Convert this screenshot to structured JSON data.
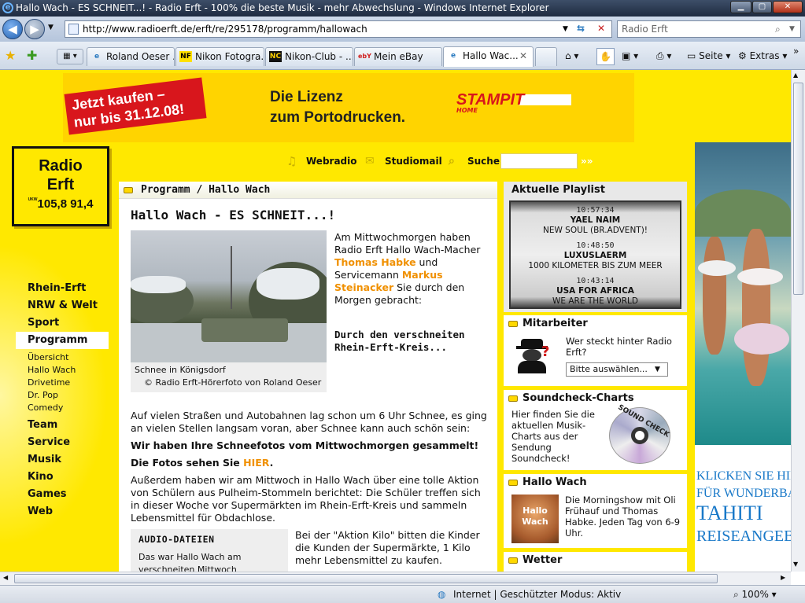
{
  "window": {
    "title": "Hallo Wach - ES SCHNEIT...! - Radio Erft - 100% die beste Musik - mehr Abwechslung - Windows Internet Explorer",
    "minimize": "▁",
    "maximize": "▢",
    "close": "✕"
  },
  "address": {
    "url": "http://www.radioerft.de/erft/re/295178/programm/hallowach",
    "search_placeholder": "Radio Erft"
  },
  "tabs": [
    {
      "label": "Roland Oeser ...",
      "fav": "e"
    },
    {
      "label": "Nikon Fotogra...",
      "fav": "NF"
    },
    {
      "label": "Nikon-Club - ...",
      "fav": "NC"
    },
    {
      "label": "Mein eBay",
      "fav": "ebY"
    },
    {
      "label": "Hallo Wac...",
      "fav": "e"
    }
  ],
  "toolbar": {
    "seite": "Seite",
    "extras": "Extras"
  },
  "banner": {
    "red_line1": "Jetzt kaufen –",
    "red_line2": "nur bis 31.12.08!",
    "text_line1": "Die Lizenz",
    "text_line2": "zum Portodrucken.",
    "brand": "STAMPIT",
    "brand_sub": "HOME"
  },
  "logo": {
    "line1": "Radio",
    "line2": "Erft",
    "freq": "105,8 91,4",
    "ukw1": "UKW",
    "ukw2": "UKW"
  },
  "topnav": {
    "webradio": "Webradio",
    "studiomail": "Studiomail",
    "suche": "Suche",
    "go": "»»"
  },
  "nav": {
    "main": [
      "Rhein-Erft",
      "NRW & Welt",
      "Sport",
      "Programm"
    ],
    "sub": [
      "Übersicht",
      "Hallo Wach",
      "Drivetime",
      "Dr. Pop",
      "Comedy"
    ],
    "more": [
      "Team",
      "Service",
      "Musik",
      "Kino",
      "Games",
      "Web"
    ]
  },
  "article": {
    "breadcrumb": "Programm / Hallo Wach",
    "title": "Hallo Wach - ES SCHNEIT...!",
    "caption": "Schnee in Königsdorf",
    "credit": "© Radio Erft-Hörerfoto von Roland Oeser",
    "intro_1": "Am Mittwochmorgen haben Radio Erft Hallo Wach-Macher ",
    "intro_name1": "Thomas Habke",
    "intro_2": " und Servicemann ",
    "intro_name2": "Markus Steinacker",
    "intro_3": " Sie durch den Morgen gebracht:",
    "subhead": "Durch den verschneiten Rhein-Erft-Kreis...",
    "para1": "Auf vielen Straßen und Autobahnen lag schon um 6 Uhr Schnee, es ging an vielen Stellen langsam voran, aber Schnee kann auch schön sein:",
    "bold1": "Wir haben Ihre Schneefotos vom Mittwochmorgen gesammelt!",
    "bold2_a": "Die Fotos sehen Sie ",
    "bold2_link": "HIER",
    "bold2_b": ".",
    "para2": "Außerdem haben wir am Mittwoch in Hallo Wach über eine tolle Aktion von Schülern aus Pulheim-Stommeln berichtet: Die Schüler treffen sich in dieser Woche vor Supermärkten im Rhein-Erft-Kreis und sammeln Lebensmittel für Obdachlose.",
    "audio_title": "AUDIO-DATEIEN",
    "audio_text": "Das war Hallo Wach am verschneiten Mittwoch",
    "aktion": "Bei der \"Aktion Kilo\" bitten die Kinder die Kunden der Supermärkte, 1 Kilo mehr Lebensmittel zu kaufen."
  },
  "playlist": {
    "title": "Aktuelle Playlist",
    "items": [
      {
        "time": "10:57:34",
        "artist": "YAEL NAIM",
        "song": "NEW SOUL (BR.ADVENT)!"
      },
      {
        "time": "10:48:50",
        "artist": "LUXUSLAERM",
        "song": "1000 KILOMETER BIS ZUM MEER"
      },
      {
        "time": "10:43:14",
        "artist": "USA FOR AFRICA",
        "song": "WE ARE THE WORLD"
      }
    ]
  },
  "mitarbeiter": {
    "title": "Mitarbeiter",
    "text": "Wer steckt hinter Radio Erft?",
    "select": "Bitte auswählen..."
  },
  "charts": {
    "title": "Soundcheck-Charts",
    "text": "Hier finden Sie die aktuellen Musik-Charts aus der Sendung Soundcheck!",
    "cd_label": "SOUND CHECK"
  },
  "hallowach": {
    "title": "Hallo Wach",
    "text": "Die Morningshow mit Oli Frühauf und Thomas Habke. Jeden Tag von 6-9 Uhr.",
    "thumb_label": "Hallo Wach"
  },
  "wetter": {
    "title": "Wetter"
  },
  "ad_right": {
    "line1": "KLICKEN SIE HIE",
    "line2": "FÜR WUNDERBA",
    "line3": "TAHITI",
    "line4": "REISEANGEBO"
  },
  "status": {
    "zone": "Internet | Geschützter Modus: Aktiv",
    "zoom": "100%"
  },
  "colors": {
    "brand_yellow": "#ffe800",
    "accent_orange": "#f09000",
    "banner_red": "#d8161c"
  }
}
